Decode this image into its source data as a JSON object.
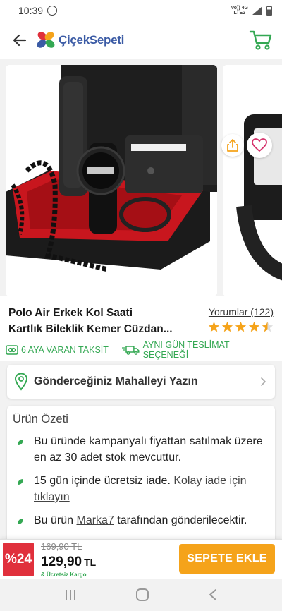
{
  "status_bar": {
    "time": "10:39",
    "network_top": "Vo)) 4G",
    "network_bottom": "LTE2"
  },
  "header": {
    "brand_name": "ÇiçekSepeti",
    "brand_colors": [
      "#e0303c",
      "#f5a31a",
      "#34a853",
      "#3b5ba5"
    ],
    "accent": "#34a853"
  },
  "product": {
    "title_line1": "Polo Air Erkek Kol Saati",
    "title_line2": "Kartlık Bileklik Kemer Cüzdan...",
    "reviews_label": "Yorumlar (122)",
    "rating": 4.5,
    "rating_max": 5
  },
  "info_strip": {
    "installment": "6 AYA VARAN TAKSİT",
    "delivery": "AYNI GÜN TESLİMAT SEÇENEĞİ"
  },
  "neighborhood": {
    "label": "Gönderceğiniz Mahalleyi Yazın"
  },
  "summary": {
    "title": "Ürün Özeti",
    "bullet1": "Bu üründe kampanyalı fiyattan satılmak üzere en az 30 adet stok mevcuttur.",
    "bullet2_text": "15 gün içinde ücretsiz iade. ",
    "bullet2_link": "Kolay iade için tıklayın",
    "bullet3_prefix": "Bu ürün ",
    "bullet3_link": "Marka7",
    "bullet3_suffix": " tarafından gönderilecektir."
  },
  "pricing": {
    "discount_badge": "%24",
    "old_price": "169,90 TL",
    "new_price": "129,90",
    "currency": "TL",
    "free_cargo": "& Ücretsiz Kargo"
  },
  "actions": {
    "add_to_cart": "SEPETE EKLE"
  }
}
